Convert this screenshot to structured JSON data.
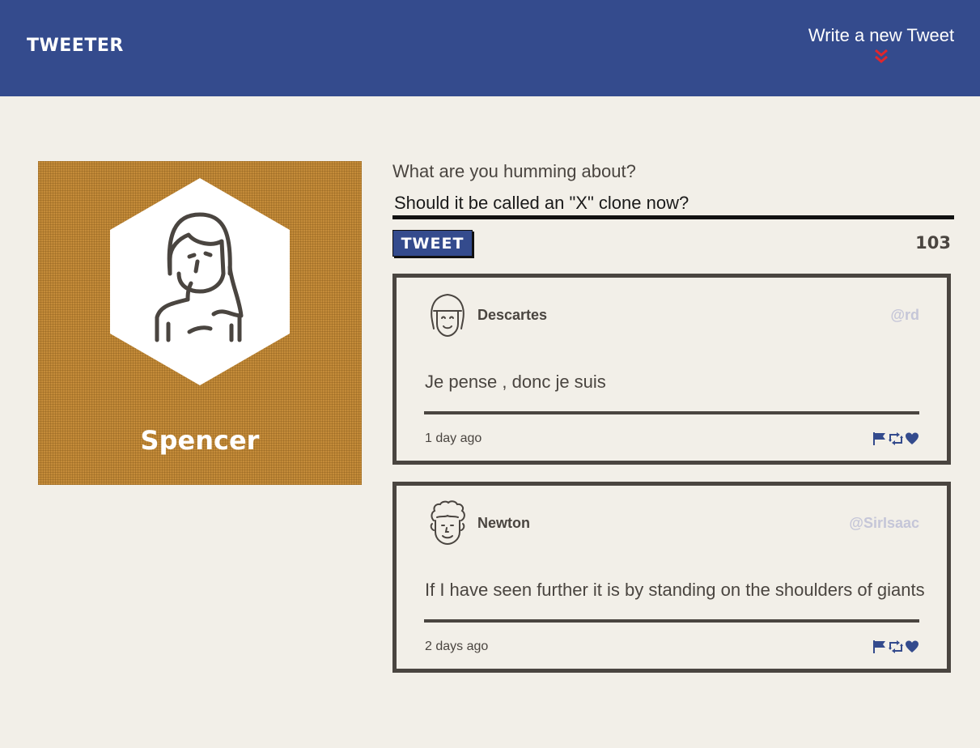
{
  "nav": {
    "brand": "TWEETER",
    "write_link": "Write a new Tweet",
    "write_icon": "double-chevron-down-icon",
    "accent": "#e0262c",
    "background": "#344b8d"
  },
  "profile": {
    "name": "Spencer",
    "avatar_icon": "user-avatar-icon",
    "background": "#c48b39"
  },
  "compose": {
    "label": "What are you humming about?",
    "value": "Should it be called an \"X\" clone now?",
    "button_label": "TWEET",
    "counter": "103"
  },
  "tweets": [
    {
      "name": "Descartes",
      "handle": "@rd",
      "text": "Je pense , donc je suis",
      "time": "1 day ago",
      "avatar_icon": "descartes-avatar-icon"
    },
    {
      "name": "Newton",
      "handle": "@SirIsaac",
      "text": "If I have seen further it is by standing on the shoulders of giants",
      "time": "2 days ago",
      "avatar_icon": "newton-avatar-icon"
    }
  ],
  "tweet_actions": [
    "flag-icon",
    "retweet-icon",
    "heart-icon"
  ],
  "colors": {
    "page_bg": "#f2efe8",
    "text": "#4a4540",
    "handle": "#c5c6d8",
    "primary": "#344b8d"
  }
}
